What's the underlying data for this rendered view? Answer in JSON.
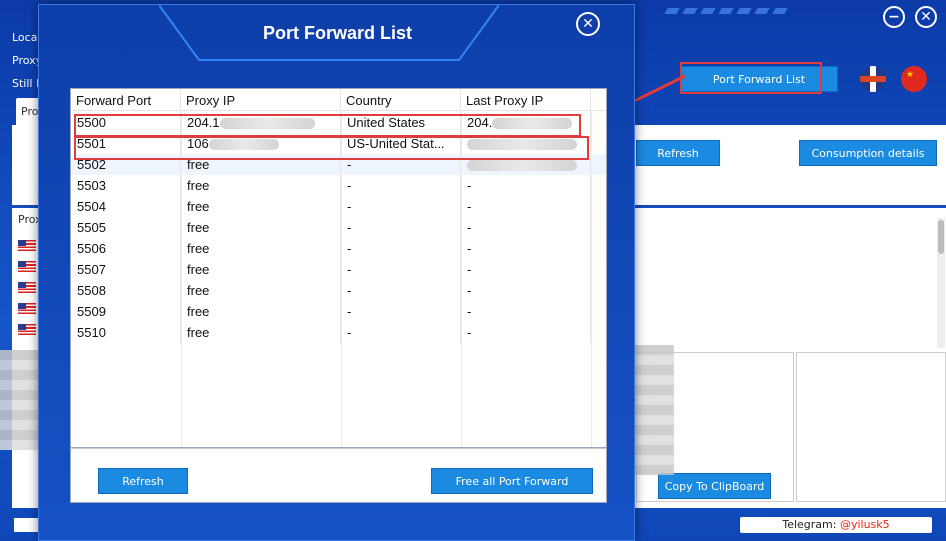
{
  "background": {
    "labels": [
      "Local",
      "Proxy",
      "Still h"
    ],
    "tab_label": "Pro",
    "proxy_column_label": "Prox",
    "port_forward_button": "Port Forward List",
    "refresh_button": "Refresh",
    "consumption_button": "Consumption details",
    "copy_button": "Copy To ClipBoard",
    "telegram_label": "Telegram: ",
    "telegram_handle": "@yilusk5",
    "minimize_icon": "minus-icon",
    "close_icon": "close-icon"
  },
  "modal": {
    "title": "Port Forward List",
    "close_icon": "close-icon",
    "columns": [
      "Forward Port",
      "Proxy IP",
      "Country",
      "Last Proxy IP"
    ],
    "rows": [
      {
        "port": "5500",
        "ip": "204.1",
        "country": "United States",
        "last_ip": "204."
      },
      {
        "port": "5501",
        "ip": "106",
        "country": "US-United Stat...",
        "last_ip": ""
      },
      {
        "port": "5502",
        "ip": "free",
        "country": "-",
        "last_ip": ""
      },
      {
        "port": "5503",
        "ip": "free",
        "country": "-",
        "last_ip": "-"
      },
      {
        "port": "5504",
        "ip": "free",
        "country": "-",
        "last_ip": "-"
      },
      {
        "port": "5505",
        "ip": "free",
        "country": "-",
        "last_ip": "-"
      },
      {
        "port": "5506",
        "ip": "free",
        "country": "-",
        "last_ip": "-"
      },
      {
        "port": "5507",
        "ip": "free",
        "country": "-",
        "last_ip": "-"
      },
      {
        "port": "5508",
        "ip": "free",
        "country": "-",
        "last_ip": "-"
      },
      {
        "port": "5509",
        "ip": "free",
        "country": "-",
        "last_ip": "-"
      },
      {
        "port": "5510",
        "ip": "free",
        "country": "-",
        "last_ip": "-"
      }
    ],
    "refresh_button": "Refresh",
    "free_all_button": "Free all Port Forward"
  },
  "colors": {
    "accent": "#1a8be0",
    "highlight": "#e23b3b",
    "background": "#0f3fae"
  }
}
